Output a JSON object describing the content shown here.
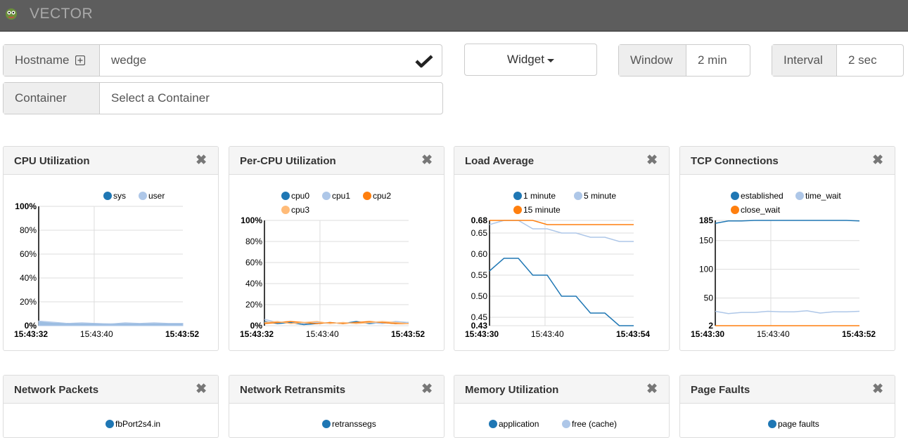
{
  "app": {
    "brand": "VECTOR"
  },
  "toolbar": {
    "hostname_label": "Hostname",
    "hostname_value": "wedge",
    "container_label": "Container",
    "container_placeholder": "Select a Container",
    "widget_label": "Widget",
    "window_label": "Window",
    "window_value": "2 min",
    "interval_label": "Interval",
    "interval_value": "2 sec"
  },
  "colors": {
    "blue": "#1f77b4",
    "lightblue": "#aec7e8",
    "orange": "#ff7f0e",
    "peach": "#ffbb78"
  },
  "icons": {
    "logo": "vector-logo-icon",
    "add": "plus-square-icon",
    "confirm": "checkmark-icon",
    "close": "close-icon",
    "dropdown": "caret-down-icon"
  },
  "widgets": [
    {
      "title": "CPU Utilization"
    },
    {
      "title": "Per-CPU Utilization"
    },
    {
      "title": "Load Average"
    },
    {
      "title": "TCP Connections"
    },
    {
      "title": "Network Packets",
      "legend": [
        "fbPort2s4.in"
      ]
    },
    {
      "title": "Network Retransmits",
      "legend": [
        "retranssegs"
      ]
    },
    {
      "title": "Memory Utilization",
      "legend": [
        "application",
        "free (cache)"
      ]
    },
    {
      "title": "Page Faults",
      "legend": [
        "page faults"
      ]
    }
  ],
  "chart_data": [
    {
      "type": "area",
      "title": "CPU Utilization",
      "series": [
        {
          "name": "sys",
          "color": "#1f77b4",
          "values": [
            3,
            2,
            2,
            1.5,
            1.5,
            1.5,
            1.5,
            1.5,
            1.5,
            1.5,
            1.5
          ]
        },
        {
          "name": "user",
          "color": "#aec7e8",
          "values": [
            4,
            3,
            2,
            2.5,
            2,
            1.5,
            2.5,
            2,
            2.5,
            2,
            2
          ]
        }
      ],
      "x": [
        "15:43:32",
        "",
        "",
        "",
        "15:43:40",
        "",
        "",
        "",
        "",
        "",
        "15:43:52"
      ],
      "xticks": [
        "15:43:32",
        "15:43:40",
        "15:43:52"
      ],
      "ylim": [
        0,
        100
      ],
      "yticks": [
        "0%",
        "20%",
        "40%",
        "60%",
        "80%",
        "100%"
      ]
    },
    {
      "type": "line",
      "title": "Per-CPU Utilization",
      "series": [
        {
          "name": "cpu0",
          "color": "#1f77b4",
          "values": [
            4,
            2,
            3,
            1,
            2,
            3,
            2,
            4,
            2,
            3,
            2,
            3
          ]
        },
        {
          "name": "cpu1",
          "color": "#aec7e8",
          "values": [
            6,
            3,
            4,
            2,
            3,
            2,
            3,
            2,
            3,
            2,
            4,
            3
          ]
        },
        {
          "name": "cpu2",
          "color": "#ff7f0e",
          "values": [
            2,
            3,
            4,
            3,
            2,
            3,
            2,
            3,
            4,
            3,
            2,
            2
          ]
        },
        {
          "name": "cpu3",
          "color": "#ffbb78",
          "values": [
            3,
            4,
            2,
            3,
            4,
            2,
            3,
            2,
            3,
            4,
            3,
            2
          ]
        }
      ],
      "xticks": [
        "15:43:32",
        "15:43:40",
        "15:43:52"
      ],
      "ylim": [
        0,
        100
      ],
      "yticks": [
        "0%",
        "20%",
        "40%",
        "60%",
        "80%",
        "100%"
      ]
    },
    {
      "type": "line",
      "title": "Load Average",
      "series": [
        {
          "name": "1 minute",
          "color": "#1f77b4",
          "values": [
            0.56,
            0.59,
            0.59,
            0.55,
            0.55,
            0.5,
            0.5,
            0.46,
            0.46,
            0.43,
            0.43
          ]
        },
        {
          "name": "5 minute",
          "color": "#aec7e8",
          "values": [
            0.67,
            0.68,
            0.68,
            0.66,
            0.66,
            0.65,
            0.65,
            0.64,
            0.64,
            0.63,
            0.63
          ]
        },
        {
          "name": "15 minute",
          "color": "#ff7f0e",
          "values": [
            0.68,
            0.68,
            0.68,
            0.68,
            0.67,
            0.67,
            0.67,
            0.67,
            0.67,
            0.67,
            0.67
          ]
        }
      ],
      "xticks": [
        "15:43:30",
        "15:43:40",
        "15:43:54"
      ],
      "ylim": [
        0.43,
        0.68
      ],
      "yticks": [
        "0.43",
        "0.45",
        "0.50",
        "0.55",
        "0.60",
        "0.65",
        "0.68"
      ]
    },
    {
      "type": "line",
      "title": "TCP Connections",
      "series": [
        {
          "name": "established",
          "color": "#1f77b4",
          "values": [
            180,
            184,
            184,
            185,
            185,
            185,
            185,
            185,
            185,
            185,
            185,
            184
          ]
        },
        {
          "name": "time_wait",
          "color": "#aec7e8",
          "values": [
            27,
            23,
            25,
            25,
            27,
            26,
            26,
            28,
            24,
            26,
            26,
            27
          ]
        },
        {
          "name": "close_wait",
          "color": "#ff7f0e",
          "values": [
            2,
            2,
            2,
            2,
            2,
            2,
            2,
            2,
            2,
            2,
            2,
            2
          ]
        }
      ],
      "xticks": [
        "15:43:30",
        "15:43:40",
        "15:43:52"
      ],
      "ylim": [
        2,
        185
      ],
      "yticks": [
        "2",
        "50",
        "100",
        "150",
        "185"
      ]
    }
  ]
}
